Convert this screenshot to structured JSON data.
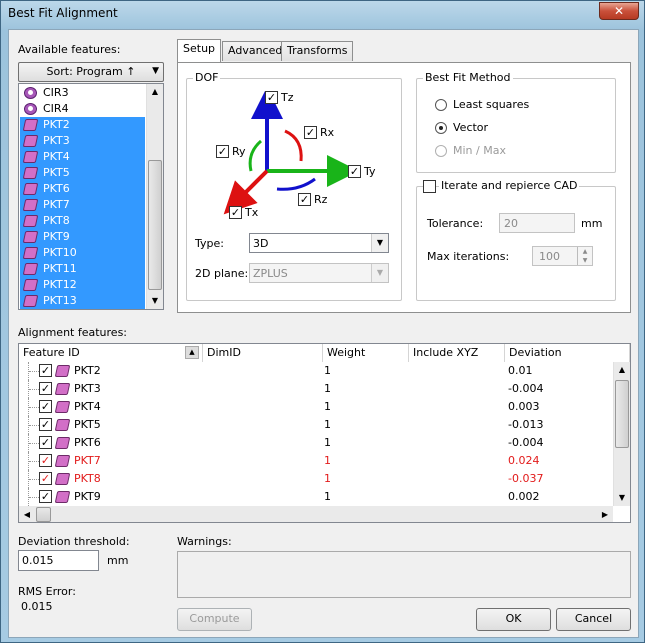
{
  "window": {
    "title": "Best Fit Alignment",
    "close_glyph": "✕"
  },
  "available": {
    "label": "Available features:",
    "sort_label": "Sort: Program ↑",
    "items": [
      {
        "name": "CIR3",
        "icon": "circle-feature-icon",
        "selected": false
      },
      {
        "name": "CIR4",
        "icon": "circle-feature-icon",
        "selected": false
      },
      {
        "name": "PKT2",
        "icon": "point-feature-icon",
        "selected": true
      },
      {
        "name": "PKT3",
        "icon": "point-feature-icon",
        "selected": true
      },
      {
        "name": "PKT4",
        "icon": "point-feature-icon",
        "selected": true
      },
      {
        "name": "PKT5",
        "icon": "point-feature-icon",
        "selected": true
      },
      {
        "name": "PKT6",
        "icon": "point-feature-icon",
        "selected": true
      },
      {
        "name": "PKT7",
        "icon": "point-feature-icon",
        "selected": true
      },
      {
        "name": "PKT8",
        "icon": "point-feature-icon",
        "selected": true
      },
      {
        "name": "PKT9",
        "icon": "point-feature-icon",
        "selected": true
      },
      {
        "name": "PKT10",
        "icon": "point-feature-icon",
        "selected": true
      },
      {
        "name": "PKT11",
        "icon": "point-feature-icon",
        "selected": true
      },
      {
        "name": "PKT12",
        "icon": "point-feature-icon",
        "selected": true
      },
      {
        "name": "PKT13",
        "icon": "point-feature-icon",
        "selected": true
      }
    ]
  },
  "tabs": [
    "Setup",
    "Advanced",
    "Transforms"
  ],
  "dof": {
    "title": "DOF",
    "tz": "Tz",
    "rx": "Rx",
    "ry": "Ry",
    "ty": "Ty",
    "rz": "Rz",
    "tx": "Tx",
    "type_label": "Type:",
    "type_value": "3D",
    "plane_label": "2D plane:",
    "plane_value": "ZPLUS"
  },
  "method": {
    "title": "Best Fit Method",
    "least_squares": "Least squares",
    "vector": "Vector",
    "minmax": "Min / Max",
    "selected": "Vector"
  },
  "iterate": {
    "title": "Iterate and repierce CAD",
    "checked": false,
    "tolerance_label": "Tolerance:",
    "tolerance_value": "20",
    "tolerance_unit": "mm",
    "max_iter_label": "Max iterations:",
    "max_iter_value": "100"
  },
  "alignment": {
    "label": "Alignment features:",
    "columns": [
      "Feature ID",
      "DimID",
      "Weight",
      "Include XYZ",
      "Deviation"
    ],
    "rows": [
      {
        "id": "PKT2",
        "weight": "1",
        "deviation": "0.01",
        "warn": false
      },
      {
        "id": "PKT3",
        "weight": "1",
        "deviation": "-0.004",
        "warn": false
      },
      {
        "id": "PKT4",
        "weight": "1",
        "deviation": "0.003",
        "warn": false
      },
      {
        "id": "PKT5",
        "weight": "1",
        "deviation": "-0.013",
        "warn": false
      },
      {
        "id": "PKT6",
        "weight": "1",
        "deviation": "-0.004",
        "warn": false
      },
      {
        "id": "PKT7",
        "weight": "1",
        "deviation": "0.024",
        "warn": true
      },
      {
        "id": "PKT8",
        "weight": "1",
        "deviation": "-0.037",
        "warn": true
      },
      {
        "id": "PKT9",
        "weight": "1",
        "deviation": "0.002",
        "warn": false
      }
    ]
  },
  "threshold": {
    "label": "Deviation threshold:",
    "value": "0.015",
    "unit": "mm"
  },
  "rms": {
    "label": "RMS Error:",
    "value": "0.015"
  },
  "warnings": {
    "label": "Warnings:"
  },
  "buttons": {
    "compute": "Compute",
    "ok": "OK",
    "cancel": "Cancel"
  },
  "colors": {
    "selection": "#3399ff",
    "warning_text": "#e21b1b",
    "axis_z": "#1111cc",
    "axis_y": "#19b419",
    "axis_x": "#dd1111"
  }
}
